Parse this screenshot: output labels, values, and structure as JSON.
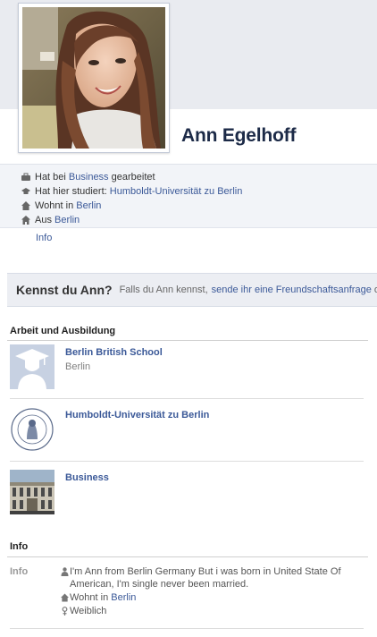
{
  "profile": {
    "name": "Ann Egelhoff"
  },
  "bio": {
    "work": {
      "icon": "briefcase-icon",
      "prefix": "Hat bei ",
      "link": "Business",
      "suffix": " gearbeitet"
    },
    "study": {
      "icon": "graduation-cap-icon",
      "prefix": "Hat hier studiert: ",
      "link": "Humboldt-Universität zu Berlin"
    },
    "lives": {
      "icon": "house-icon",
      "prefix": "Wohnt in ",
      "link": "Berlin"
    },
    "from": {
      "icon": "home-town-icon",
      "prefix": "Aus ",
      "link": "Berlin"
    }
  },
  "info_link": "Info",
  "kennst": {
    "title": "Kennst du Ann?",
    "text": "Falls du Ann kennst,",
    "link": "sende ihr eine Freundschaftsanfrage",
    "tail": "od"
  },
  "work_education": {
    "heading": "Arbeit und Ausbildung",
    "items": [
      {
        "name": "Berlin British School",
        "sub": "Berlin",
        "thumb": "graduation-placeholder"
      },
      {
        "name": "Humboldt-Universität zu Berlin",
        "sub": "",
        "thumb": "university-seal"
      },
      {
        "name": "Business",
        "sub": "",
        "thumb": "building-photo"
      }
    ]
  },
  "info": {
    "heading": "Info",
    "label": "Info",
    "about": "I'm Ann from Berlin Germany But i was born in United State Of American, I'm single never been married.",
    "lives_prefix": "Wohnt in ",
    "lives_link": "Berlin",
    "gender": "Weiblich"
  },
  "colors": {
    "link": "#3b5998",
    "name": "#1c2a47",
    "band": "#f2f4f8"
  }
}
